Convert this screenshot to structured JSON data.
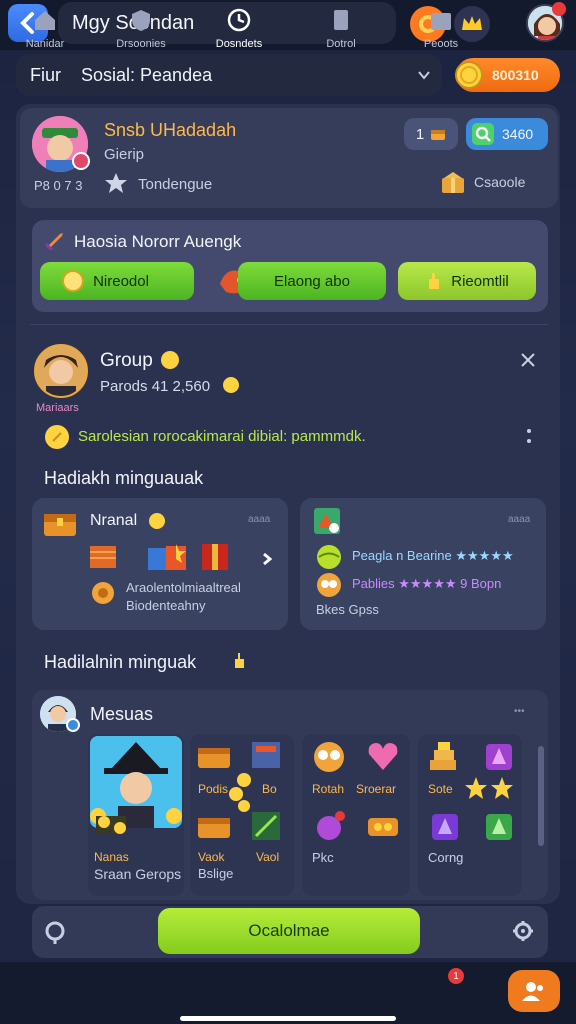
{
  "header": {
    "title": "Mgy Scondan",
    "back_icon": "chevron-left-icon"
  },
  "filter": {
    "left": "Fiur",
    "label": "Sosial: Peandea"
  },
  "coins": {
    "value": "800310"
  },
  "profile": {
    "name": "Snsb UHadadah",
    "sub": "Gierip",
    "id": "P8 0 7 3",
    "tag": "Tondengue",
    "right_label": "Csaoole",
    "level": "1",
    "badge_value": "3460"
  },
  "quest": {
    "title": "Haosia Nororr Auengk",
    "btn1": "Nireodol",
    "btn2": "Elaong abo",
    "btn3": "Rieomtlil"
  },
  "group": {
    "title": "Group",
    "sub": "Parods 41 2,560",
    "label": "Mariaars",
    "message": "Sarolesian rorocakimarai dibial: pammmdk."
  },
  "section1": {
    "title": "Hadiakh minguauak"
  },
  "cards": {
    "left": {
      "title": "Nranal",
      "tag": "aaaa",
      "line1": "Araolentolmiaaltreal",
      "line2": "Biodenteahny"
    },
    "right": {
      "tag": "aaaa",
      "row1": "Peagla n Bearine ★★★★★",
      "row2": "Pablies ★★★★★ 9 Bopn",
      "foot": "Bkes Gpss"
    }
  },
  "section2": {
    "title": "Hadilalnin minguak"
  },
  "members": {
    "title": "Mesuas",
    "cols": [
      {
        "a": "Nanas",
        "b": "Sraan Gerops"
      },
      {
        "a": "Podis",
        "b": "Bo",
        "c": "Vaok",
        "d": "Vaol",
        "e": "Bslige"
      },
      {
        "a": "Rotah",
        "b": "Sroerar",
        "c": "Pkc"
      },
      {
        "a": "Sote",
        "b": "Corng"
      }
    ]
  },
  "action": {
    "button": "Ocalolmae"
  },
  "nav": [
    {
      "label": "Nanidar",
      "icon": "home-icon"
    },
    {
      "label": "Drsoonies",
      "icon": "shield-icon"
    },
    {
      "label": "Dosndets",
      "icon": "clock-icon"
    },
    {
      "label": "Dotrol",
      "icon": "card-icon"
    },
    {
      "label": "Peoots",
      "icon": "inbox-icon",
      "badge": "1"
    }
  ],
  "colors": {
    "accent": "#f07a1e",
    "green": "#5ccb2a",
    "panel": "#2b3250",
    "gold": "#ffd23f"
  }
}
